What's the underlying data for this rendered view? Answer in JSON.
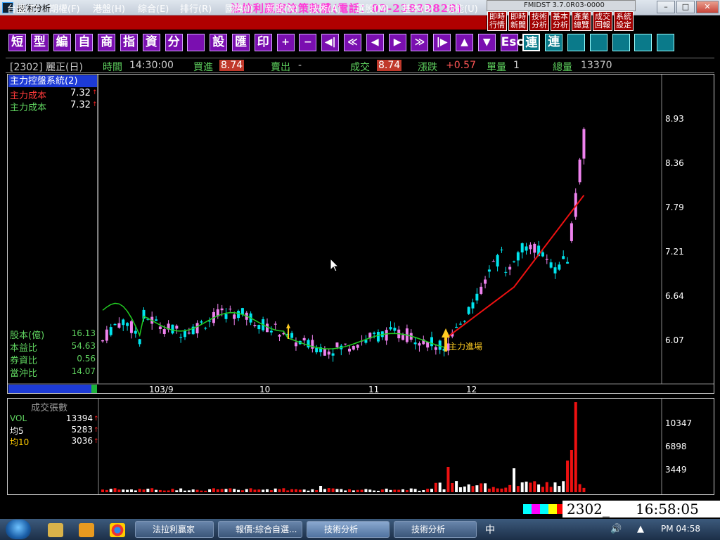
{
  "window": {
    "title": "技術分析",
    "promo": "法拉利贏家決策軟體(電話：02-23832828)",
    "version": "FMIDST 3.7.0R03-0000"
  },
  "menu": [
    "台盤(T)",
    "期權(F)",
    "港盤(H)",
    "綜合(E)",
    "排行(R)",
    "國際(I)",
    "新聞(N)",
    "技術(A)",
    "選股(M)",
    "基本(B)",
    "功能(U)"
  ],
  "quick_buttons": [
    "即時\n行情",
    "即時\n新聞",
    "技術\n分析",
    "基本\n分析",
    "產業\n總覽",
    "成交\n回報",
    "系統\n設定"
  ],
  "toolbar": [
    "短",
    "型",
    "編",
    "自",
    "商",
    "指",
    "資",
    "分",
    "",
    "設",
    "匯",
    "印",
    "+",
    "−",
    "◀|",
    "≪",
    "◀",
    "▶",
    "≫",
    "|▶",
    "▲",
    "▼",
    "Esc",
    "連",
    "連",
    "",
    "",
    "",
    "",
    ""
  ],
  "info": {
    "symbol": "[2302] 麗正(日)",
    "time_label": "時間",
    "time": "14:30:00",
    "bid_label": "買進",
    "bid": "8.74",
    "ask_label": "賣出",
    "ask": "-",
    "deal_label": "成交",
    "deal": "8.74",
    "change_label": "漲跌",
    "change": "+0.57",
    "lot_label": "單量",
    "lot": "1",
    "total_label": "總量",
    "total": "13370"
  },
  "left_panel": {
    "title": "主力控盤系統(2)",
    "rows": [
      {
        "label": "主力成本",
        "value": "7.32",
        "color": "#ff3a3a"
      },
      {
        "label": "主力成本",
        "value": "7.32",
        "color": "#5fd35f"
      }
    ],
    "stats": [
      {
        "label": "股本(億)",
        "value": "16.13"
      },
      {
        "label": "本益比",
        "value": "54.63"
      },
      {
        "label": "券資比",
        "value": "0.56"
      },
      {
        "label": "當沖比",
        "value": "14.07"
      }
    ]
  },
  "price_axis": [
    "8.93",
    "8.36",
    "7.79",
    "7.21",
    "6.64",
    "6.07"
  ],
  "x_axis": [
    "103/9",
    "10",
    "11",
    "12"
  ],
  "annotation": "主力進場",
  "volume": {
    "title": "成交張數",
    "rows": [
      {
        "label": "VOL",
        "value": "13394",
        "color": "#5fd35f"
      },
      {
        "label": "均5",
        "value": "5283",
        "color": "#ffffff"
      },
      {
        "label": "均10",
        "value": "3036",
        "color": "#ffcc00"
      }
    ],
    "axis": [
      "10347",
      "6898",
      "3449"
    ]
  },
  "status": {
    "symbol": "2302_",
    "clock": "16:58:05"
  },
  "taskbar": {
    "buttons": [
      {
        "label": "法拉利贏家",
        "active": false
      },
      {
        "label": "報價:綜合自選...",
        "active": false
      },
      {
        "label": "技術分析",
        "active": true
      },
      {
        "label": "技術分析",
        "active": false
      }
    ],
    "ime": "中",
    "time": "PM 04:58"
  },
  "colors": {
    "up": "#ee82ee",
    "down": "#00e5ee",
    "ma_green": "#22cc22",
    "ma_red": "#ee1111",
    "accent": "#b00000"
  }
}
